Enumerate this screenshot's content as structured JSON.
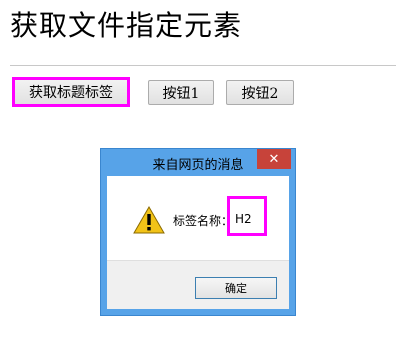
{
  "page": {
    "title": "获取文件指定元素"
  },
  "buttons": {
    "get_tag": "获取标题标签",
    "button1": "按钮1",
    "button2": "按钮2"
  },
  "dialog": {
    "title": "来自网页的消息",
    "close_glyph": "✕",
    "message_label": "标签名称：",
    "message_value": "H2",
    "ok_label": "确定",
    "icon": "warning-icon"
  },
  "colors": {
    "highlight": "#ff00ff",
    "titlebar": "#57a3e8",
    "close": "#c7433a"
  }
}
